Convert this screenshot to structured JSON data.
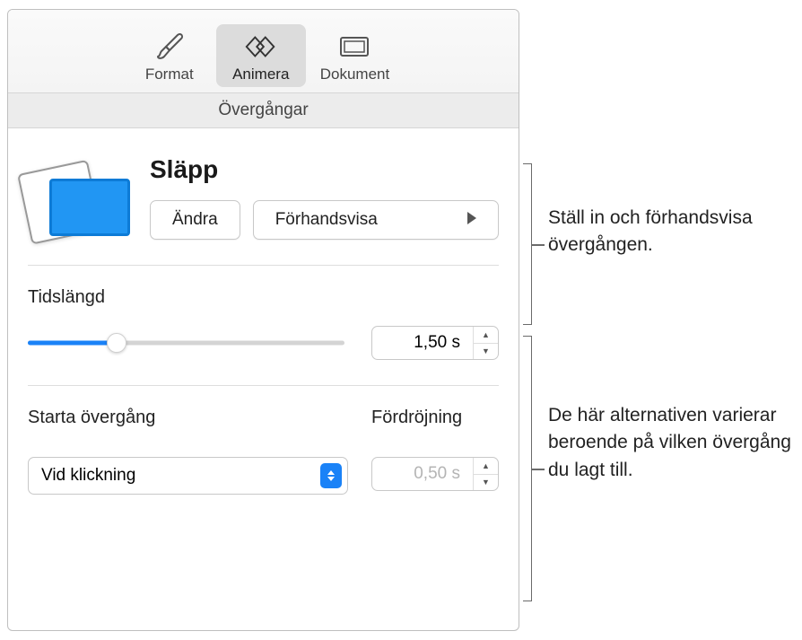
{
  "toolbar": {
    "format_label": "Format",
    "animate_label": "Animera",
    "document_label": "Dokument"
  },
  "section_header": "Övergångar",
  "transition": {
    "name": "Släpp",
    "change_label": "Ändra",
    "preview_label": "Förhandsvisa"
  },
  "duration": {
    "label": "Tidslängd",
    "value": "1,50 s"
  },
  "start": {
    "label": "Starta övergång",
    "value": "Vid klickning"
  },
  "delay": {
    "label": "Fördröjning",
    "value": "0,50 s"
  },
  "annotations": {
    "a1": "Ställ in och förhandsvisa övergången.",
    "a2": "De här alternativen varierar beroende på vilken övergång du lagt till."
  }
}
